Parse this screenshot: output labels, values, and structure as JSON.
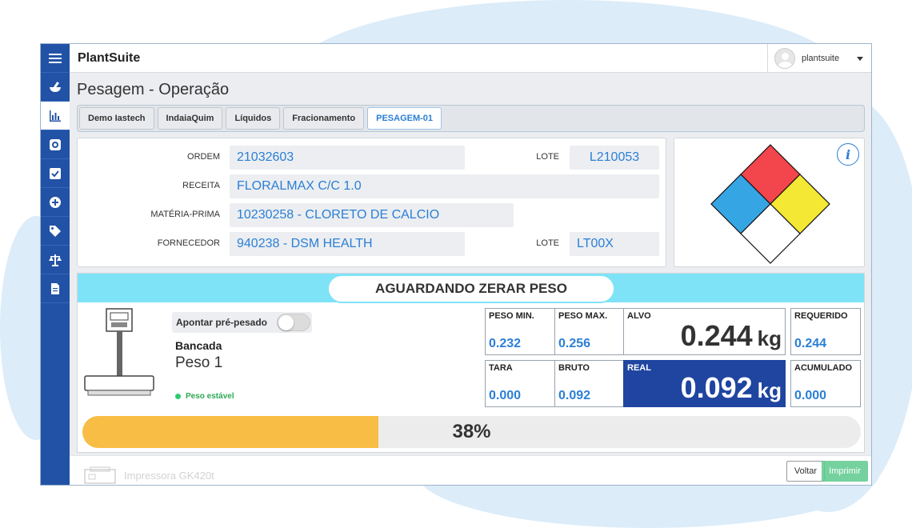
{
  "app": {
    "brand": "PlantSuite",
    "user": "plantsuite"
  },
  "page": {
    "title": "Pesagem - Operação"
  },
  "breadcrumb": [
    {
      "label": "Demo Iastech",
      "active": false
    },
    {
      "label": "IndaiaQuim",
      "active": false
    },
    {
      "label": "Líquidos",
      "active": false
    },
    {
      "label": "Fracionamento",
      "active": false
    },
    {
      "label": "PESAGEM-01",
      "active": true
    }
  ],
  "info": {
    "ordem_label": "ORDEM",
    "ordem": "21032603",
    "lote1_label": "LOTE",
    "lote1": "L210053",
    "receita_label": "RECEITA",
    "receita": "FLORALMAX C/C 1.0",
    "materia_label": "MATÉRIA-PRIMA",
    "materia": "10230258 - CLORETO DE CALCIO",
    "fornecedor_label": "FORNECEDOR",
    "fornecedor": "940238 - DSM HEALTH",
    "lote2_label": "LOTE",
    "lote2": "LT00X",
    "info_icon": "i"
  },
  "hazard": {
    "colors": {
      "top": "#f2454c",
      "left": "#36a5e3",
      "right": "#f4e835",
      "bottom": "#ffffff"
    }
  },
  "status": {
    "text": "AGUARDANDO ZERAR PESO",
    "color": "#7fe3f8"
  },
  "scale": {
    "toggle_label": "Apontar pré-pesado",
    "bancada": "Bancada",
    "peso": "Peso 1",
    "stable": "Peso estável"
  },
  "metrics": {
    "peso_min": {
      "label": "PESO MIN.",
      "value": "0.232"
    },
    "peso_max": {
      "label": "PESO MAX.",
      "value": "0.256"
    },
    "alvo": {
      "label": "ALVO",
      "value": "0.244",
      "unit": "kg"
    },
    "requerido": {
      "label": "REQUERIDO",
      "value": "0.244"
    },
    "tara": {
      "label": "TARA",
      "value": "0.000"
    },
    "bruto": {
      "label": "BRUTO",
      "value": "0.092"
    },
    "real": {
      "label": "REAL",
      "value": "0.092",
      "unit": "kg"
    },
    "acumulado": {
      "label": "ACUMULADO",
      "value": "0.000"
    }
  },
  "progress": {
    "percent": 38,
    "label": "38%",
    "color": "#f8bd45"
  },
  "footer": {
    "printer": "Impressora GK420t",
    "voltar": "Voltar",
    "imprimir": "Imprimir"
  },
  "sidebar_icons": [
    "menu-icon",
    "mortar-pestle-icon",
    "chart-icon",
    "scale-bowl-icon",
    "checkbox-icon",
    "plus-circle-icon",
    "tag-icon",
    "balance-icon",
    "document-icon"
  ]
}
